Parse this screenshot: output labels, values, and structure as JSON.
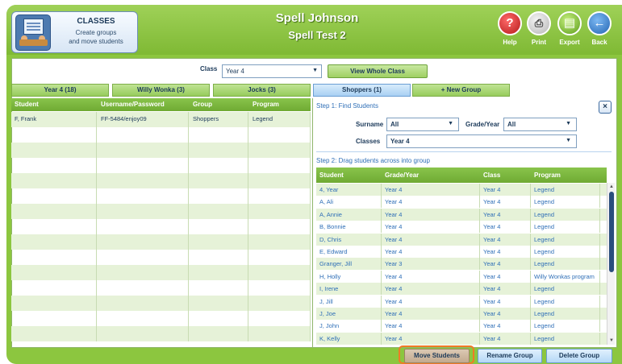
{
  "header": {
    "section_title": "CLASSES",
    "section_subtitle_1": "Create groups",
    "section_subtitle_2": "and move students",
    "student_name": "Spell Johnson",
    "test_name": "Spell Test 2",
    "buttons": {
      "help": "Help",
      "print": "Print",
      "export": "Export",
      "back": "Back"
    }
  },
  "class_bar": {
    "label": "Class",
    "selected": "Year 4",
    "view_whole": "View Whole Class"
  },
  "tabs": [
    {
      "label": "Year 4 (18)",
      "active": false
    },
    {
      "label": "Willy Wonka (3)",
      "active": false
    },
    {
      "label": "Jocks (3)",
      "active": false
    },
    {
      "label": "Shoppers (1)",
      "active": true
    },
    {
      "label": "+ New Group",
      "active": false
    }
  ],
  "group_table": {
    "headers": [
      "Student",
      "Username/Password",
      "Group",
      "Program"
    ],
    "rows": [
      [
        "F, Frank",
        "FF-5484/enjoy09",
        "Shoppers",
        "Legend"
      ]
    ]
  },
  "find_panel": {
    "step1": "Step 1: Find Students",
    "surname_label": "Surname",
    "surname_value": "All",
    "grade_label": "Grade/Year",
    "grade_value": "All",
    "classes_label": "Classes",
    "classes_value": "Year 4",
    "step2": "Step 2: Drag students across into group",
    "close": "×"
  },
  "students_table": {
    "headers": [
      "Student",
      "Grade/Year",
      "Class",
      "Program"
    ],
    "rows": [
      [
        "4, Year",
        "Year 4",
        "Year 4",
        "Legend"
      ],
      [
        "A, Ali",
        "Year 4",
        "Year 4",
        "Legend"
      ],
      [
        "A, Annie",
        "Year 4",
        "Year 4",
        "Legend"
      ],
      [
        "B, Bonnie",
        "Year 4",
        "Year 4",
        "Legend"
      ],
      [
        "D, Chris",
        "Year 4",
        "Year 4",
        "Legend"
      ],
      [
        "E, Edward",
        "Year 4",
        "Year 4",
        "Legend"
      ],
      [
        "Granger, Jill",
        "Year 3",
        "Year 4",
        "Legend"
      ],
      [
        "H, Holly",
        "Year 4",
        "Year 4",
        "Willy Wonkas program"
      ],
      [
        "I, Irene",
        "Year 4",
        "Year 4",
        "Legend"
      ],
      [
        "J, Jill",
        "Year 4",
        "Year 4",
        "Legend"
      ],
      [
        "J, Joe",
        "Year 4",
        "Year 4",
        "Legend"
      ],
      [
        "J, John",
        "Year 4",
        "Year 4",
        "Legend"
      ],
      [
        "K, Kelly",
        "Year 4",
        "Year 4",
        "Legend"
      ]
    ]
  },
  "actions": {
    "move": "Move Students",
    "rename": "Rename Group",
    "delete": "Delete Group"
  },
  "colors": {
    "frame_green": "#8cc63f",
    "header_green": "#6faa33",
    "active_tab_blue": "#a9d0f3",
    "highlight_orange": "#f07a25"
  },
  "icons": [
    "classroom-icon",
    "help-icon",
    "print-icon",
    "export-icon",
    "back-icon",
    "close-icon",
    "dropdown-caret-icon"
  ]
}
